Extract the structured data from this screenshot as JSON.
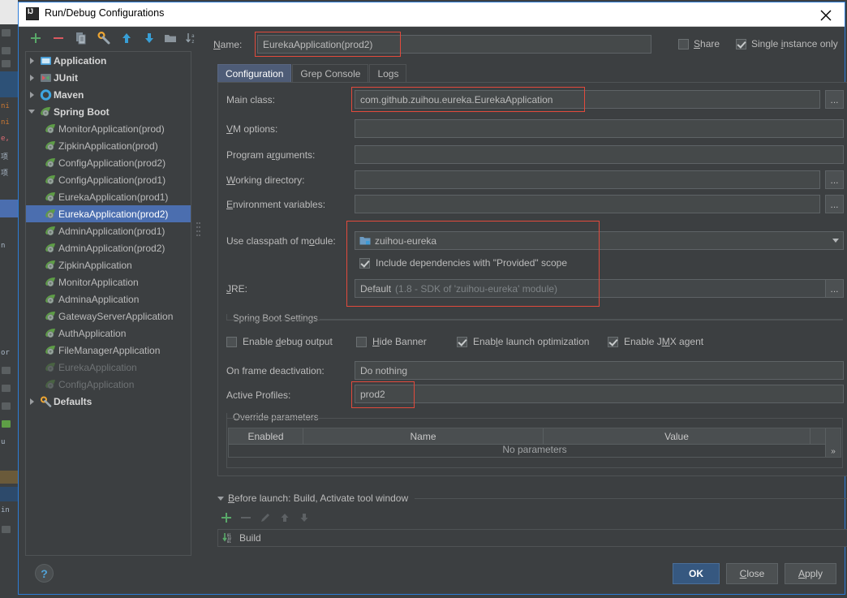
{
  "window": {
    "title": "Run/Debug Configurations",
    "app_icon": "intellij-idea-icon",
    "close_icon": "close-icon"
  },
  "tree_toolbar": {
    "items": [
      {
        "name": "add-configuration-button",
        "icon": "plus-icon",
        "color": "#59a869"
      },
      {
        "name": "remove-configuration-button",
        "icon": "minus-icon",
        "color": "#db5860"
      },
      {
        "name": "copy-configuration-button",
        "icon": "copy-icon",
        "color": "#9aa7b0"
      },
      {
        "name": "edit-templates-button",
        "icon": "wrench-icon",
        "color": "#f0a732"
      },
      {
        "name": "move-up-button",
        "icon": "arrow-up-icon",
        "color": "#389fd6"
      },
      {
        "name": "move-down-button",
        "icon": "arrow-down-icon",
        "color": "#389fd6"
      },
      {
        "name": "move-into-folder-button",
        "icon": "folder-icon",
        "color": "#9aa7b0"
      },
      {
        "name": "sort-alphabetically-button",
        "icon": "sort-az-icon",
        "color": "#9aa7b0"
      }
    ]
  },
  "tree": {
    "nodes": [
      {
        "label": "Application",
        "type": "group",
        "expanded": false,
        "icon": "application-icon",
        "selected": false,
        "dim": false
      },
      {
        "label": "JUnit",
        "type": "group",
        "expanded": false,
        "icon": "junit-icon",
        "selected": false,
        "dim": false
      },
      {
        "label": "Maven",
        "type": "group",
        "expanded": false,
        "icon": "maven-icon",
        "selected": false,
        "dim": false
      },
      {
        "label": "Spring Boot",
        "type": "group",
        "expanded": true,
        "icon": "spring-boot-icon",
        "selected": false,
        "dim": false
      },
      {
        "label": "MonitorApplication(prod)",
        "type": "child",
        "icon": "spring-boot-icon",
        "selected": false,
        "dim": false
      },
      {
        "label": "ZipkinApplication(prod)",
        "type": "child",
        "icon": "spring-boot-icon",
        "selected": false,
        "dim": false
      },
      {
        "label": "ConfigApplication(prod2)",
        "type": "child",
        "icon": "spring-boot-icon",
        "selected": false,
        "dim": false
      },
      {
        "label": "ConfigApplication(prod1)",
        "type": "child",
        "icon": "spring-boot-icon",
        "selected": false,
        "dim": false
      },
      {
        "label": "EurekaApplication(prod1)",
        "type": "child",
        "icon": "spring-boot-icon",
        "selected": false,
        "dim": false
      },
      {
        "label": "EurekaApplication(prod2)",
        "type": "child",
        "icon": "spring-boot-icon",
        "selected": true,
        "dim": false
      },
      {
        "label": "AdminApplication(prod1)",
        "type": "child",
        "icon": "spring-boot-icon",
        "selected": false,
        "dim": false
      },
      {
        "label": "AdminApplication(prod2)",
        "type": "child",
        "icon": "spring-boot-icon",
        "selected": false,
        "dim": false
      },
      {
        "label": "ZipkinApplication",
        "type": "child",
        "icon": "spring-boot-icon",
        "selected": false,
        "dim": false
      },
      {
        "label": "MonitorApplication",
        "type": "child",
        "icon": "spring-boot-icon",
        "selected": false,
        "dim": false
      },
      {
        "label": "AdminaApplication",
        "type": "child",
        "icon": "spring-boot-icon",
        "selected": false,
        "dim": false
      },
      {
        "label": "GatewayServerApplication",
        "type": "child",
        "icon": "spring-boot-icon",
        "selected": false,
        "dim": false
      },
      {
        "label": "AuthApplication",
        "type": "child",
        "icon": "spring-boot-icon",
        "selected": false,
        "dim": false
      },
      {
        "label": "FileManagerApplication",
        "type": "child",
        "icon": "spring-boot-icon",
        "selected": false,
        "dim": false
      },
      {
        "label": "EurekaApplication",
        "type": "child",
        "icon": "spring-boot-icon",
        "selected": false,
        "dim": true
      },
      {
        "label": "ConfigApplication",
        "type": "child",
        "icon": "spring-boot-icon",
        "selected": false,
        "dim": true
      },
      {
        "label": "Defaults",
        "type": "group",
        "expanded": false,
        "icon": "defaults-wrench-icon",
        "selected": false,
        "dim": false
      }
    ]
  },
  "name_row": {
    "label": "Name:",
    "value": "EurekaApplication(prod2)"
  },
  "top_right": {
    "share_label": "Share",
    "share_checked": false,
    "single_instance_label": "Single instance only",
    "single_instance_checked": true
  },
  "tabs": [
    {
      "label": "Configuration",
      "active": true
    },
    {
      "label": "Grep Console",
      "active": false
    },
    {
      "label": "Logs",
      "active": false
    }
  ],
  "configuration": {
    "main_class": {
      "label": "Main class:",
      "value": "com.github.zuihou.eureka.EurekaApplication",
      "browse": "..."
    },
    "vm_options": {
      "label": "VM options:",
      "value": "",
      "expand_icon": "expand-icon"
    },
    "program_arguments": {
      "label": "Program arguments:",
      "value": "",
      "expand_icon": "expand-icon"
    },
    "working_directory": {
      "label": "Working directory:",
      "value": "",
      "dropdown_icon": "chevron-down-icon",
      "browse": "..."
    },
    "environment_variables": {
      "label": "Environment variables:",
      "value": "",
      "browse": "..."
    },
    "use_classpath_of_module": {
      "label": "Use classpath of module:",
      "value": "zuihou-eureka",
      "module_icon": "module-icon",
      "dropdown_icon": "chevron-down-icon"
    },
    "include_provided": {
      "label": "Include dependencies with \"Provided\" scope",
      "checked": true
    },
    "jre": {
      "label": "JRE:",
      "value": "Default",
      "hint": "(1.8 - SDK of 'zuihou-eureka' module)",
      "dropdown_icon": "chevron-down-icon",
      "browse": "..."
    }
  },
  "spring_boot_settings": {
    "title": "Spring Boot Settings",
    "checkboxes": [
      {
        "label": "Enable debug output",
        "checked": false,
        "underline_char": "d"
      },
      {
        "label": "Hide Banner",
        "checked": false,
        "underline_char": "H"
      },
      {
        "label": "Enable launch optimization",
        "checked": true,
        "underline_char": "l"
      },
      {
        "label": "Enable JMX agent",
        "checked": true,
        "underline_char": "M"
      }
    ],
    "on_frame_deactivation": {
      "label": "On frame deactivation:",
      "value": "Do nothing",
      "dropdown_icon": "chevron-down-icon"
    },
    "active_profiles": {
      "label": "Active Profiles:",
      "value": "prod2"
    },
    "override_parameters": {
      "title": "Override parameters",
      "columns": [
        "Enabled",
        "Name",
        "Value"
      ],
      "empty_text": "No parameters",
      "more_icon": "chevron-double-right-icon"
    }
  },
  "before_launch": {
    "title": "Before launch: Build, Activate tool window",
    "toolbar": [
      {
        "name": "add-task-button",
        "icon": "plus-icon",
        "enabled": true
      },
      {
        "name": "remove-task-button",
        "icon": "minus-icon",
        "enabled": false
      },
      {
        "name": "edit-task-button",
        "icon": "pencil-icon",
        "enabled": false
      },
      {
        "name": "move-task-up-button",
        "icon": "arrow-up-icon",
        "enabled": false
      },
      {
        "name": "move-task-down-button",
        "icon": "arrow-down-icon",
        "enabled": false
      }
    ],
    "items": [
      {
        "label": "Build",
        "icon": "build-icon"
      }
    ]
  },
  "footer": {
    "help_label": "?",
    "buttons": [
      {
        "label": "OK",
        "primary": true,
        "name": "ok-button"
      },
      {
        "label": "Close",
        "primary": false,
        "name": "close-button"
      },
      {
        "label": "Apply",
        "primary": false,
        "name": "apply-button"
      }
    ]
  },
  "colors": {
    "dialog_bg": "#3c3f41",
    "selection_blue": "#4b6eaf",
    "highlight_red": "#e24a3c",
    "accent_border": "#2d7cd6",
    "primary_button": "#365880",
    "text": "#bbbbbb",
    "spring_green": "#5e9e46"
  }
}
